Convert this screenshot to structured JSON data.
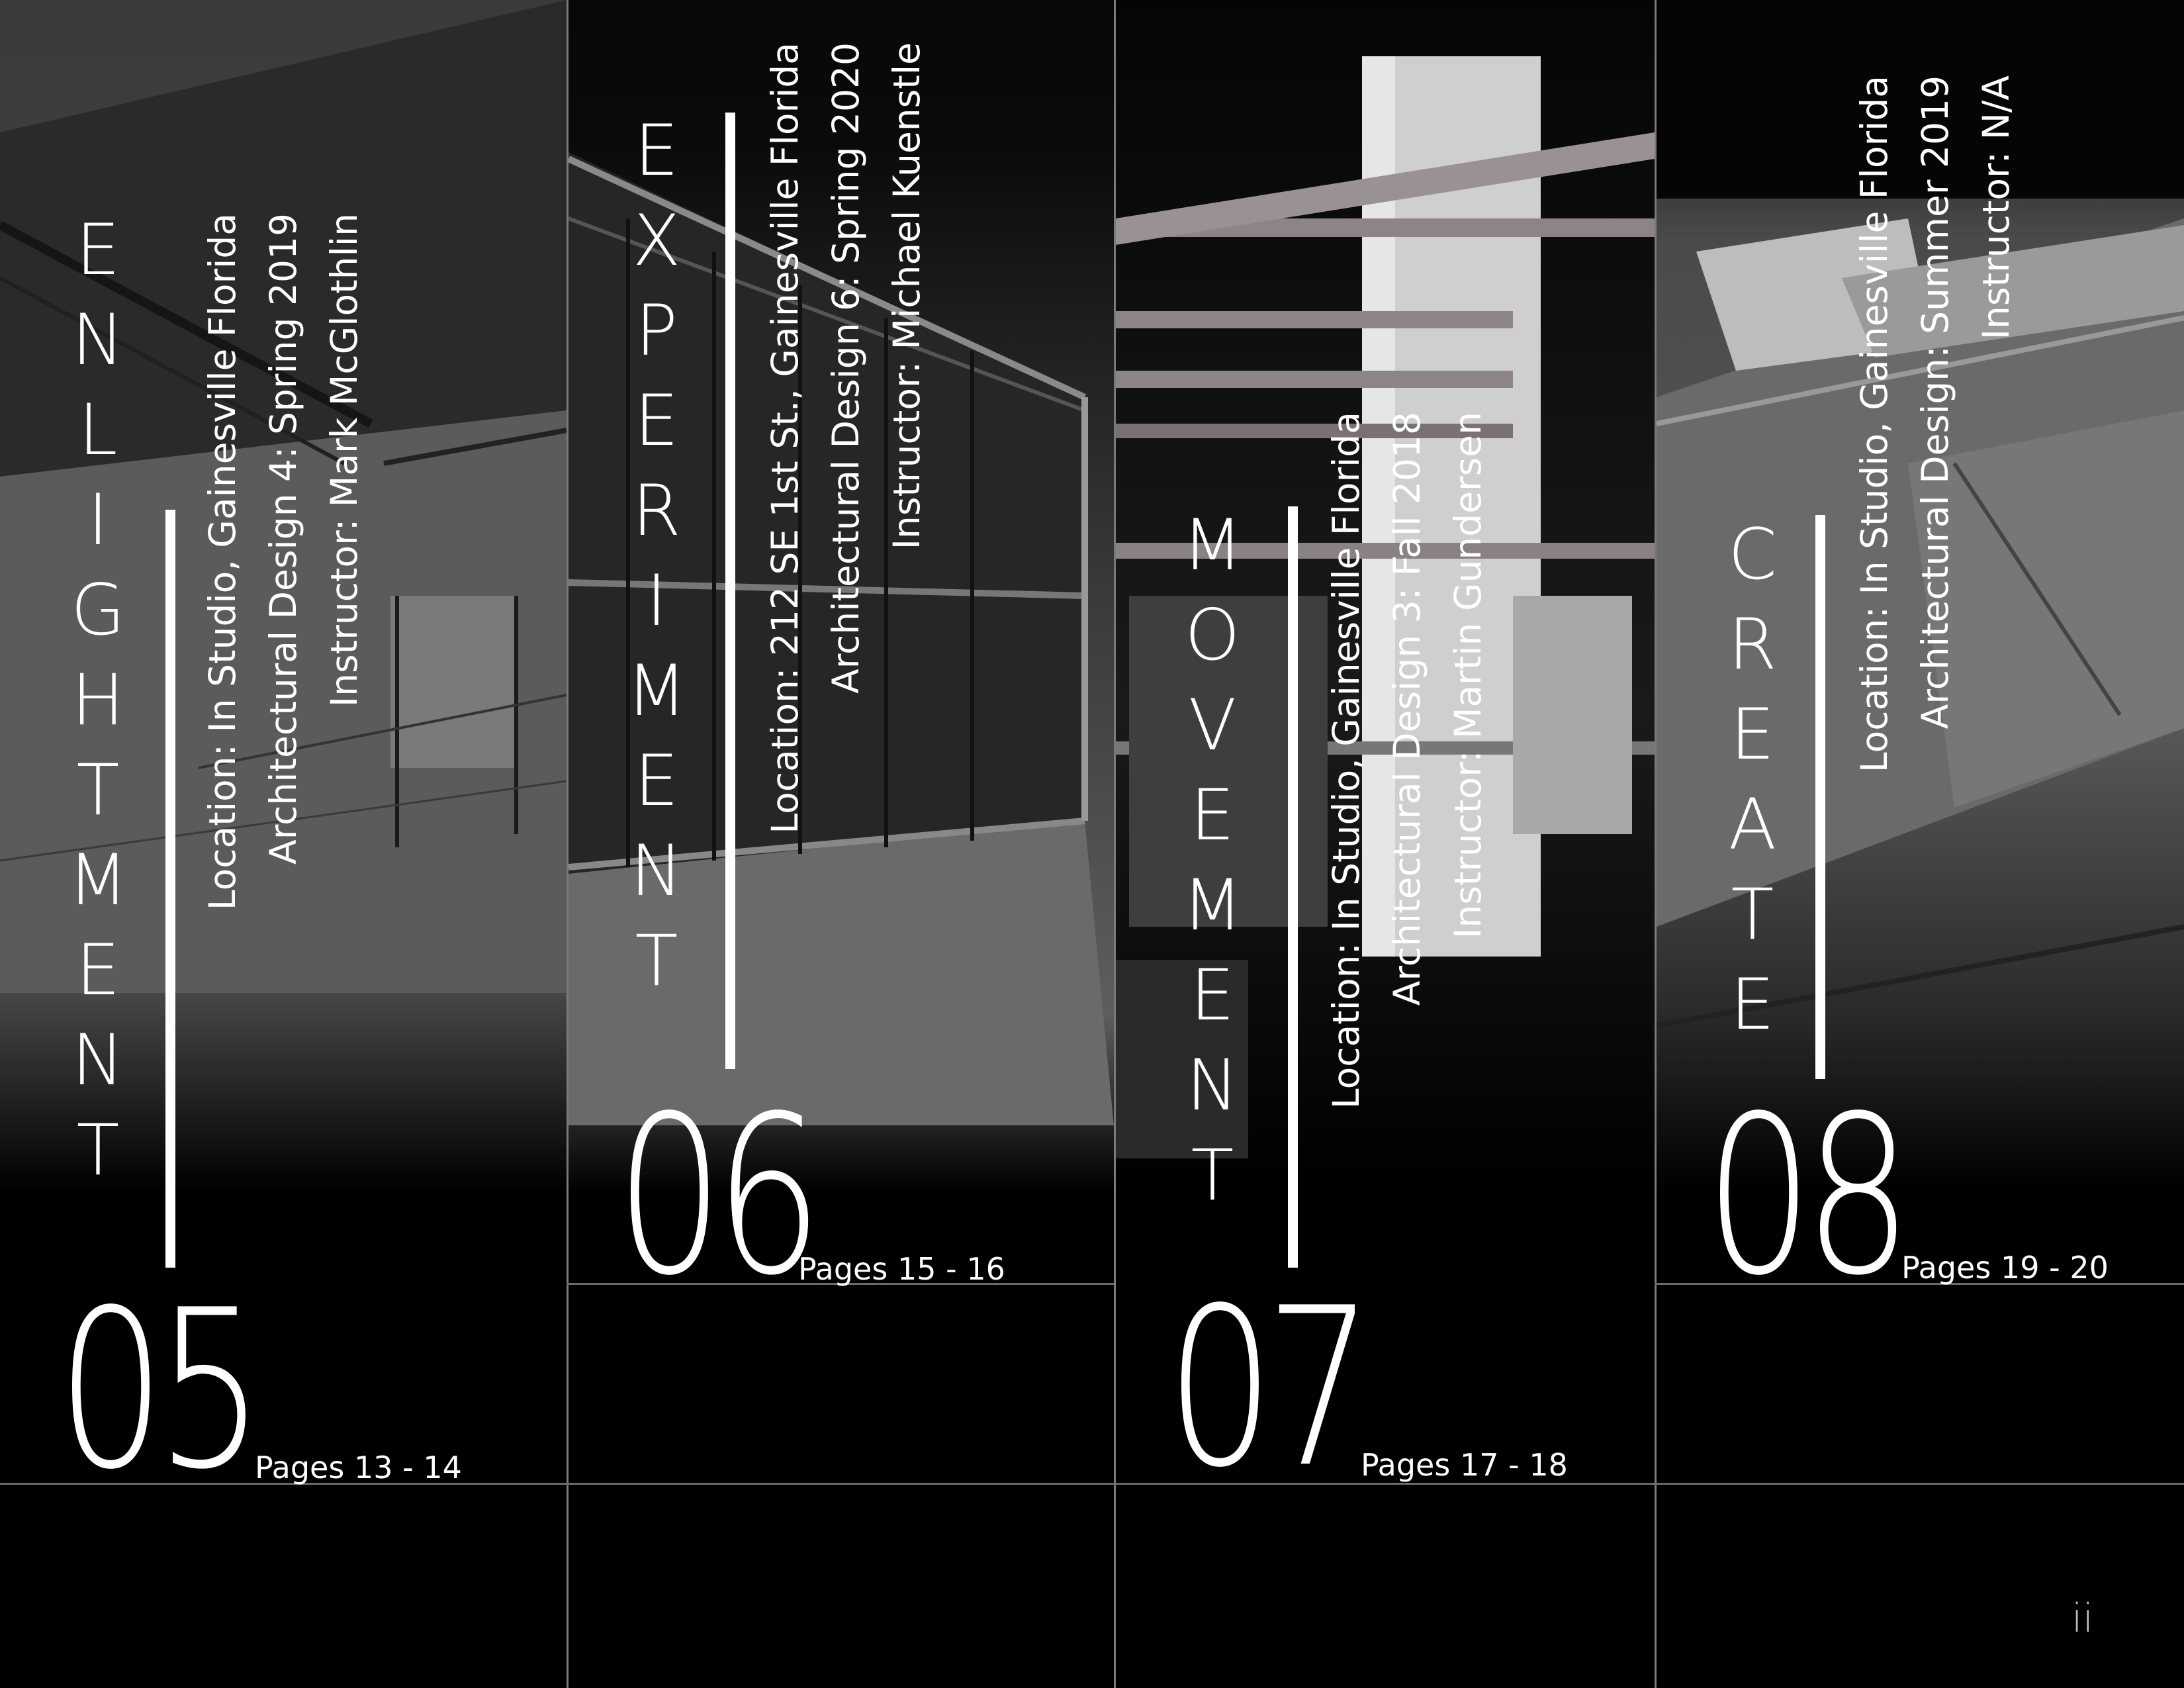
{
  "sections": [
    {
      "title_letters": [
        "E",
        "N",
        "L",
        "I",
        "G",
        "H",
        "T",
        "M",
        "E",
        "N",
        "T"
      ],
      "number": "05",
      "pages": "Pages 13 - 14",
      "location": "Location: In Studio, Gainesville Florida",
      "course": "Architectural Design 4: Spring 2019",
      "instructor": "Instructor: Mark McGlothlin"
    },
    {
      "title_letters": [
        "E",
        "X",
        "P",
        "E",
        "R",
        "I",
        "M",
        "E",
        "N",
        "T"
      ],
      "number": "06",
      "pages": "Pages 15 - 16",
      "location": "Location: 212 SE 1st St., Gainesville Florida",
      "course": "Architectural Design 6: Spring 2020",
      "instructor": "Instructor: Michael Kuenstle"
    },
    {
      "title_letters": [
        "M",
        "O",
        "V",
        "E",
        "M",
        "E",
        "N",
        "T"
      ],
      "number": "07",
      "pages": "Pages 17 - 18",
      "location": "Location: In Studio, Gainesville Florida",
      "course": "Architectural Design 3: Fall 2018",
      "instructor": "Instructor: Martin Gundersen"
    },
    {
      "title_letters": [
        "C",
        "R",
        "E",
        "A",
        "T",
        "E"
      ],
      "number": "08",
      "pages": "Pages 19 - 20",
      "location": "Location: In Studio, Gainesville Florida",
      "course": "Architectural Design: Summer 2019",
      "instructor": "Instructor: N/A"
    }
  ],
  "page_number": "ii"
}
